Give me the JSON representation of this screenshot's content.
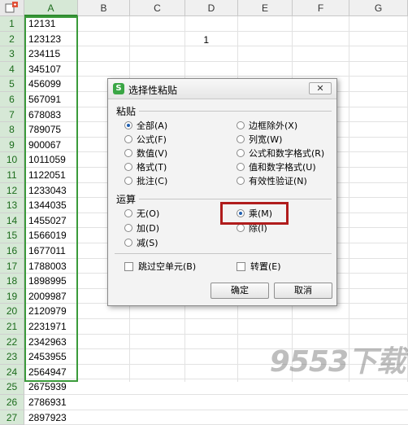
{
  "columns": [
    "A",
    "B",
    "C",
    "D",
    "E",
    "F",
    "G"
  ],
  "rows": [
    "1",
    "2",
    "3",
    "4",
    "5",
    "6",
    "7",
    "8",
    "9",
    "10",
    "11",
    "12",
    "13",
    "14",
    "15",
    "16",
    "17",
    "18",
    "19",
    "20",
    "21",
    "22",
    "23",
    "24",
    "25",
    "26",
    "27"
  ],
  "column_a_values": [
    "12131",
    "123123",
    "234115",
    "345107",
    "456099",
    "567091",
    "678083",
    "789075",
    "900067",
    "1011059",
    "1122051",
    "1233043",
    "1344035",
    "1455027",
    "1566019",
    "1677011",
    "1788003",
    "1898995",
    "2009987",
    "2120979",
    "2231971",
    "2342963",
    "2453955",
    "2564947",
    "2675939",
    "2786931",
    "2897923"
  ],
  "c2_value": "1",
  "dialog": {
    "title": "选择性粘贴",
    "paste_section": "粘贴",
    "paste_left": [
      "全部(A)",
      "公式(F)",
      "数值(V)",
      "格式(T)",
      "批注(C)"
    ],
    "paste_right": [
      "边框除外(X)",
      "列宽(W)",
      "公式和数字格式(R)",
      "值和数字格式(U)",
      "有效性验证(N)"
    ],
    "paste_selected": "全部(A)",
    "operation_section": "运算",
    "operation_left": [
      "无(O)",
      "加(D)",
      "减(S)"
    ],
    "operation_right": [
      "乘(M)",
      "除(I)"
    ],
    "operation_selected": "乘(M)",
    "skip_blanks": "跳过空单元(B)",
    "transpose": "转置(E)",
    "ok": "确定",
    "cancel": "取消"
  },
  "watermark": "9553下载",
  "colors": {
    "selection": "#3a9a3a",
    "highlight": "#b01c1c",
    "radio_dot": "#1f5fb0"
  }
}
